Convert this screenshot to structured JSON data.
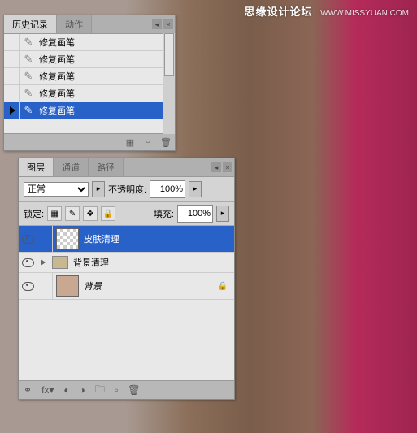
{
  "watermark": {
    "cn": "思缘设计论坛",
    "url": "WWW.MISSYUAN.COM"
  },
  "history": {
    "tabs": {
      "history": "历史记录",
      "actions": "动作"
    },
    "items": [
      {
        "label": "修复画笔"
      },
      {
        "label": "修复画笔"
      },
      {
        "label": "修复画笔"
      },
      {
        "label": "修复画笔"
      },
      {
        "label": "修复画笔"
      }
    ]
  },
  "layers": {
    "tabs": {
      "layers": "图层",
      "channels": "通道",
      "paths": "路径"
    },
    "blend_mode": "正常",
    "opacity_label": "不透明度:",
    "opacity_value": "100%",
    "lock_label": "锁定:",
    "fill_label": "填充:",
    "fill_value": "100%",
    "items": [
      {
        "name": "皮肤清理"
      },
      {
        "name": "背景清理"
      },
      {
        "name": "背景"
      }
    ]
  }
}
